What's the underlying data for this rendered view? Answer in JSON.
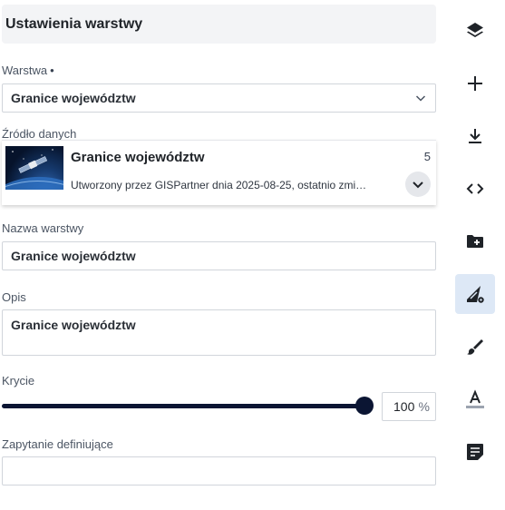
{
  "header": {
    "title": "Ustawienia warstwy"
  },
  "layer": {
    "label": "Warstwa",
    "required_mark": "•",
    "selected": "Granice województw"
  },
  "data_source": {
    "label": "Źródło danych",
    "title": "Granice województw",
    "count": "5",
    "description": "Utworzony przez GISPartner dnia 2025-08-25, ostatnio zmi…"
  },
  "layer_name": {
    "label": "Nazwa warstwy",
    "value": "Granice województw"
  },
  "description": {
    "label": "Opis",
    "value": "Granice województw"
  },
  "opacity": {
    "label": "Krycie",
    "value": "100",
    "unit": "%",
    "fraction": 1.0
  },
  "defining_query": {
    "label": "Zapytanie definiujące",
    "value": ""
  },
  "rail": {
    "items": [
      {
        "icon": "layers-icon"
      },
      {
        "icon": "plus-icon"
      },
      {
        "icon": "download-icon"
      },
      {
        "icon": "code-icon"
      },
      {
        "icon": "folder-add-icon"
      },
      {
        "icon": "layer-style-settings-icon",
        "active": true
      },
      {
        "icon": "brush-icon"
      },
      {
        "icon": "text-color-icon"
      },
      {
        "icon": "note-icon"
      }
    ]
  },
  "colors": {
    "accent": "#0b1533",
    "active_bg": "#dde8f6",
    "header_bg": "#f3f4f6"
  }
}
